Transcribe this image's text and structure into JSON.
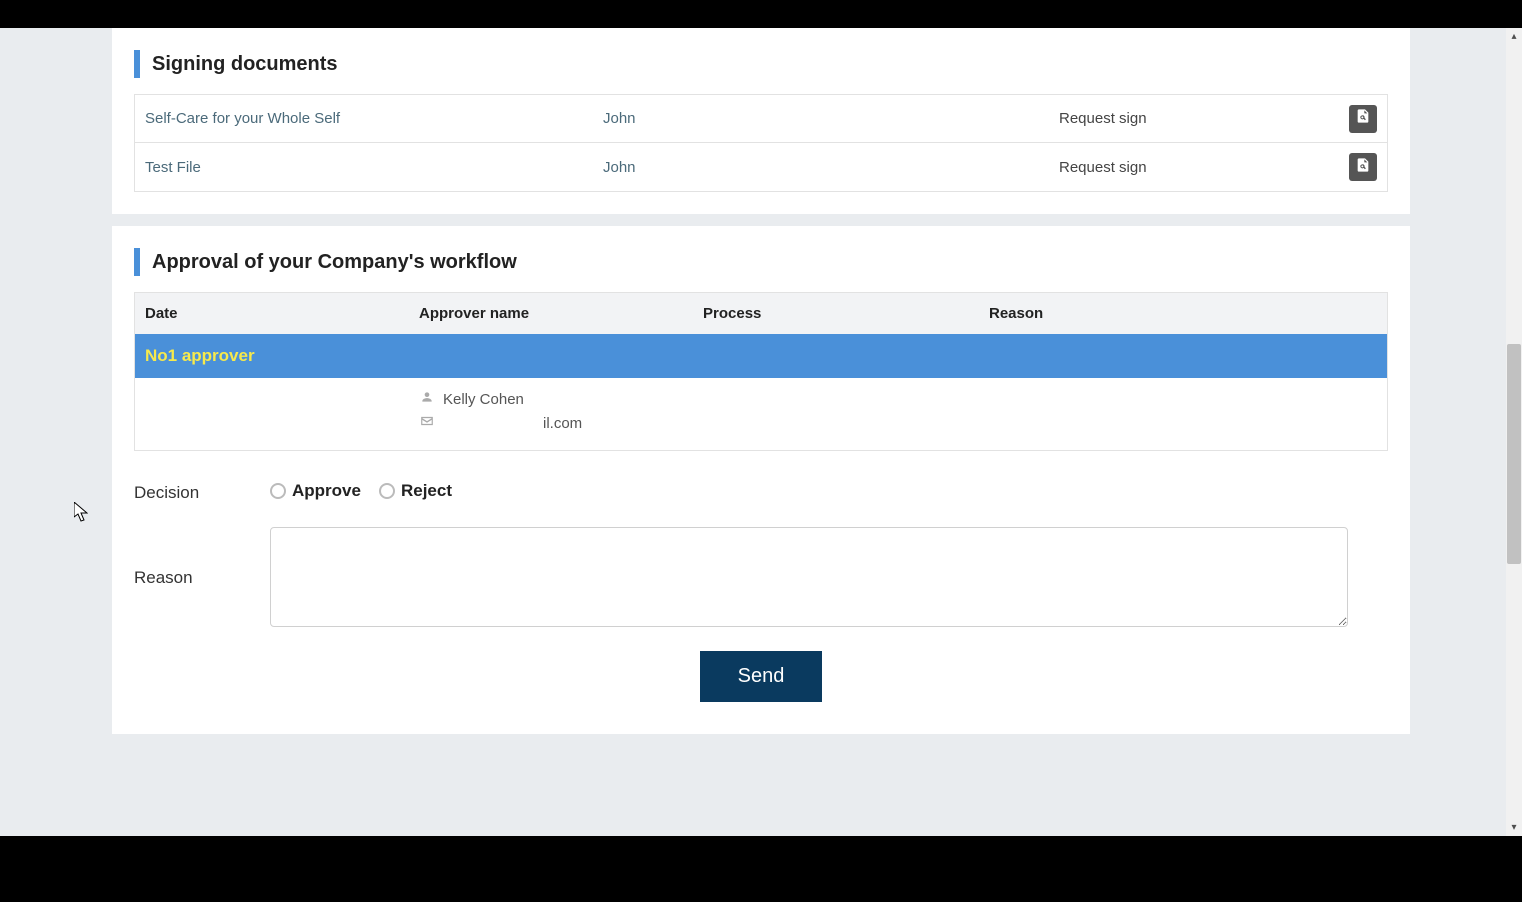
{
  "colors": {
    "accent": "#4a90d9",
    "send_button": "#0a3a5f",
    "group_text": "#f6e94c"
  },
  "signing": {
    "title": "Signing documents",
    "rows": [
      {
        "name": "Self-Care for your Whole Self",
        "signer": "John",
        "status": "Request sign"
      },
      {
        "name": "Test File",
        "signer": "John",
        "status": "Request sign"
      }
    ]
  },
  "approval": {
    "title": "Approval of your Company's workflow",
    "columns": {
      "date": "Date",
      "approver": "Approver name",
      "process": "Process",
      "reason": "Reason"
    },
    "group_label": "No1 approver",
    "approver": {
      "name": "Kelly Cohen",
      "email_suffix": "il.com"
    }
  },
  "form": {
    "decision_label": "Decision",
    "reason_label": "Reason",
    "approve_label": "Approve",
    "reject_label": "Reject",
    "send_label": "Send",
    "reason_value": ""
  }
}
